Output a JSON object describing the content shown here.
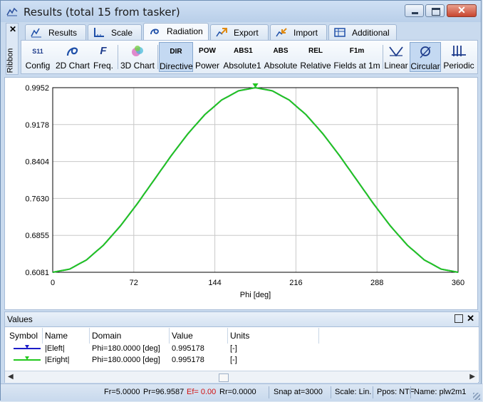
{
  "window": {
    "title": "Results (total 15 from tasker)",
    "close_glyph": "✕"
  },
  "ribbon": {
    "side_label": "Ribbon",
    "collapse_glyph": "✕"
  },
  "tabs": [
    {
      "label": "Results",
      "icon": "results-icon",
      "active": false
    },
    {
      "label": "Scale",
      "icon": "scale-icon",
      "active": false
    },
    {
      "label": "Radiation",
      "icon": "radiation-icon",
      "active": true
    },
    {
      "label": "Export",
      "icon": "export-icon",
      "active": false
    },
    {
      "label": "Import",
      "icon": "import-icon",
      "active": false
    },
    {
      "label": "Additional",
      "icon": "additional-icon",
      "active": false
    }
  ],
  "toolbar": {
    "config": {
      "label": "Config",
      "glyph": "S11"
    },
    "chart2d": {
      "label": "2D Chart"
    },
    "freq": {
      "label": "Freq.",
      "glyph": "F"
    },
    "chart3d": {
      "label": "3D Chart"
    },
    "directive": {
      "label": "Directive",
      "glyph": "DIR"
    },
    "power": {
      "label": "Power",
      "glyph": "POW"
    },
    "absolute1": {
      "label": "Absolute1",
      "glyph": "ABS1"
    },
    "absolute": {
      "label": "Absolute",
      "glyph": "ABS"
    },
    "relative": {
      "label": "Relative",
      "glyph": "REL"
    },
    "fields1m": {
      "label": "Fields at 1m",
      "glyph": "F1m"
    },
    "linear": {
      "label": "Linear"
    },
    "circular": {
      "label": "Circular"
    },
    "periodic": {
      "label": "Periodic"
    }
  },
  "chart_data": {
    "type": "line",
    "xlabel": "Phi [deg]",
    "ylabel": "",
    "xlim": [
      0,
      360
    ],
    "ylim": [
      0.6081,
      0.9952
    ],
    "x_ticks": [
      "0",
      "72",
      "144",
      "216",
      "288",
      "360"
    ],
    "y_ticks": [
      "0.9952",
      "0.9178",
      "0.8404",
      "0.7630",
      "0.6855",
      "0.6081"
    ],
    "grid": true,
    "series": [
      {
        "name": "|Eleft|",
        "color": "#1c1cc8",
        "x": [
          0,
          15,
          30,
          45,
          60,
          75,
          90,
          105,
          120,
          135,
          150,
          165,
          180,
          195,
          210,
          225,
          240,
          255,
          270,
          285,
          300,
          315,
          330,
          345,
          360
        ],
        "y": [
          0.6081,
          0.6147,
          0.634,
          0.6648,
          0.7049,
          0.7515,
          0.8016,
          0.8518,
          0.8984,
          0.9385,
          0.9693,
          0.9886,
          0.9952,
          0.9886,
          0.9693,
          0.9385,
          0.8984,
          0.8518,
          0.8016,
          0.7515,
          0.7049,
          0.6648,
          0.634,
          0.6147,
          0.6081
        ]
      },
      {
        "name": "|Eright|",
        "color": "#22c81e",
        "x": [
          0,
          15,
          30,
          45,
          60,
          75,
          90,
          105,
          120,
          135,
          150,
          165,
          180,
          195,
          210,
          225,
          240,
          255,
          270,
          285,
          300,
          315,
          330,
          345,
          360
        ],
        "y": [
          0.6081,
          0.6147,
          0.634,
          0.6648,
          0.7049,
          0.7515,
          0.8016,
          0.8518,
          0.8984,
          0.9385,
          0.9693,
          0.9886,
          0.9952,
          0.9886,
          0.9693,
          0.9385,
          0.8984,
          0.8518,
          0.8016,
          0.7515,
          0.7049,
          0.6648,
          0.634,
          0.6147,
          0.6081
        ]
      }
    ],
    "marker_x": 180
  },
  "values_panel": {
    "title": "Values",
    "columns": [
      "Symbol",
      "Name",
      "Domain",
      "Value",
      "Units"
    ],
    "rows": [
      {
        "name": "|Eleft|",
        "domain": "Phi=180.0000 [deg]",
        "value": "0.995178",
        "units": "[-]",
        "color": "#1c1cc8"
      },
      {
        "name": "|Eright|",
        "domain": "Phi=180.0000 [deg]",
        "value": "0.995178",
        "units": "[-]",
        "color": "#22c81e"
      }
    ]
  },
  "status": {
    "fr": "Fr=5.0000",
    "pr": "Pr=96.9587",
    "ef": "Ef= 0.00",
    "rr": "Rr=0.0000",
    "snap": "Snap at=3000",
    "scale": "Scale: Lin.",
    "ppos": "Ppos: NTF",
    "name": "Name: plw2m1"
  }
}
